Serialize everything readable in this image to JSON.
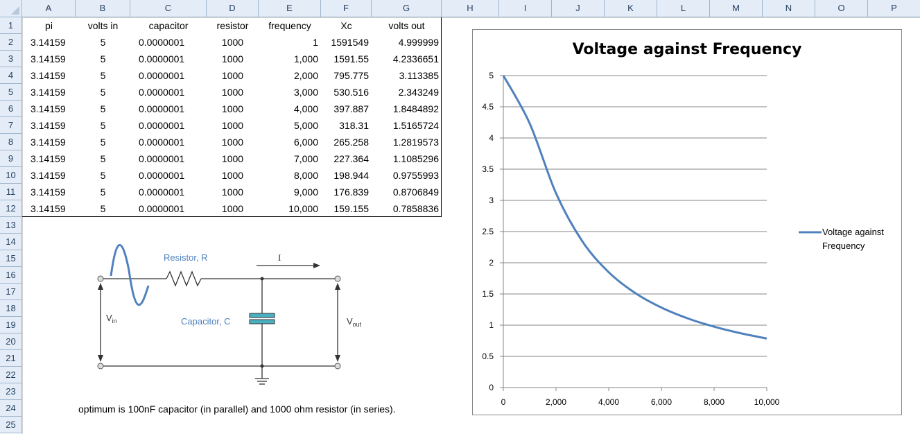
{
  "columns": [
    "A",
    "B",
    "C",
    "D",
    "E",
    "F",
    "G",
    "H",
    "I",
    "J",
    "K",
    "L",
    "M",
    "N",
    "O",
    "P"
  ],
  "rows": [
    "1",
    "2",
    "3",
    "4",
    "5",
    "6",
    "7",
    "8",
    "9",
    "10",
    "11",
    "12",
    "13",
    "14",
    "15",
    "16",
    "17",
    "18",
    "19",
    "20",
    "21",
    "22",
    "23",
    "24",
    "25"
  ],
  "table": {
    "headers": [
      "pi",
      "volts in",
      "capacitor",
      "resistor",
      "frequency",
      "Xc",
      "volts out"
    ],
    "rows": [
      [
        "3.14159",
        "5",
        "0.0000001",
        "1000",
        "1",
        "1591549",
        "4.999999"
      ],
      [
        "3.14159",
        "5",
        "0.0000001",
        "1000",
        "1,000",
        "1591.55",
        "4.2336651"
      ],
      [
        "3.14159",
        "5",
        "0.0000001",
        "1000",
        "2,000",
        "795.775",
        "3.113385"
      ],
      [
        "3.14159",
        "5",
        "0.0000001",
        "1000",
        "3,000",
        "530.516",
        "2.343249"
      ],
      [
        "3.14159",
        "5",
        "0.0000001",
        "1000",
        "4,000",
        "397.887",
        "1.8484892"
      ],
      [
        "3.14159",
        "5",
        "0.0000001",
        "1000",
        "5,000",
        "318.31",
        "1.5165724"
      ],
      [
        "3.14159",
        "5",
        "0.0000001",
        "1000",
        "6,000",
        "265.258",
        "1.2819573"
      ],
      [
        "3.14159",
        "5",
        "0.0000001",
        "1000",
        "7,000",
        "227.364",
        "1.1085296"
      ],
      [
        "3.14159",
        "5",
        "0.0000001",
        "1000",
        "8,000",
        "198.944",
        "0.9755993"
      ],
      [
        "3.14159",
        "5",
        "0.0000001",
        "1000",
        "9,000",
        "176.839",
        "0.8706849"
      ],
      [
        "3.14159",
        "5",
        "0.0000001",
        "1000",
        "10,000",
        "159.155",
        "0.7858836"
      ]
    ]
  },
  "circuit": {
    "resistor_label": "Resistor, R",
    "current_label": "I",
    "vin_label": "V",
    "vin_sub": "in",
    "capacitor_label": "Capacitor, C",
    "vout_label": "V",
    "vout_sub": "out"
  },
  "note": "optimum is 100nF capacitor (in parallel) and 1000 ohm resistor (in series).",
  "chart_data": {
    "type": "line",
    "title": "Voltage against Frequency",
    "x": [
      1,
      1000,
      2000,
      3000,
      4000,
      5000,
      6000,
      7000,
      8000,
      9000,
      10000
    ],
    "series": [
      {
        "name": "Voltage against Frequency",
        "values": [
          4.999999,
          4.2336651,
          3.113385,
          2.343249,
          1.8484892,
          1.5165724,
          1.2819573,
          1.1085296,
          0.9755993,
          0.8706849,
          0.7858836
        ],
        "color": "#4f81bd"
      }
    ],
    "xlim": [
      0,
      10000
    ],
    "ylim": [
      0,
      5
    ],
    "x_ticks": [
      "0",
      "2,000",
      "4,000",
      "6,000",
      "8,000",
      "10,000"
    ],
    "y_ticks": [
      "0",
      "0.5",
      "1",
      "1.5",
      "2",
      "2.5",
      "3",
      "3.5",
      "4",
      "4.5",
      "5"
    ],
    "xlabel": "",
    "ylabel": "",
    "grid": "horizontal",
    "legend": "right",
    "legend_text": [
      "Voltage against",
      "Frequency"
    ]
  }
}
